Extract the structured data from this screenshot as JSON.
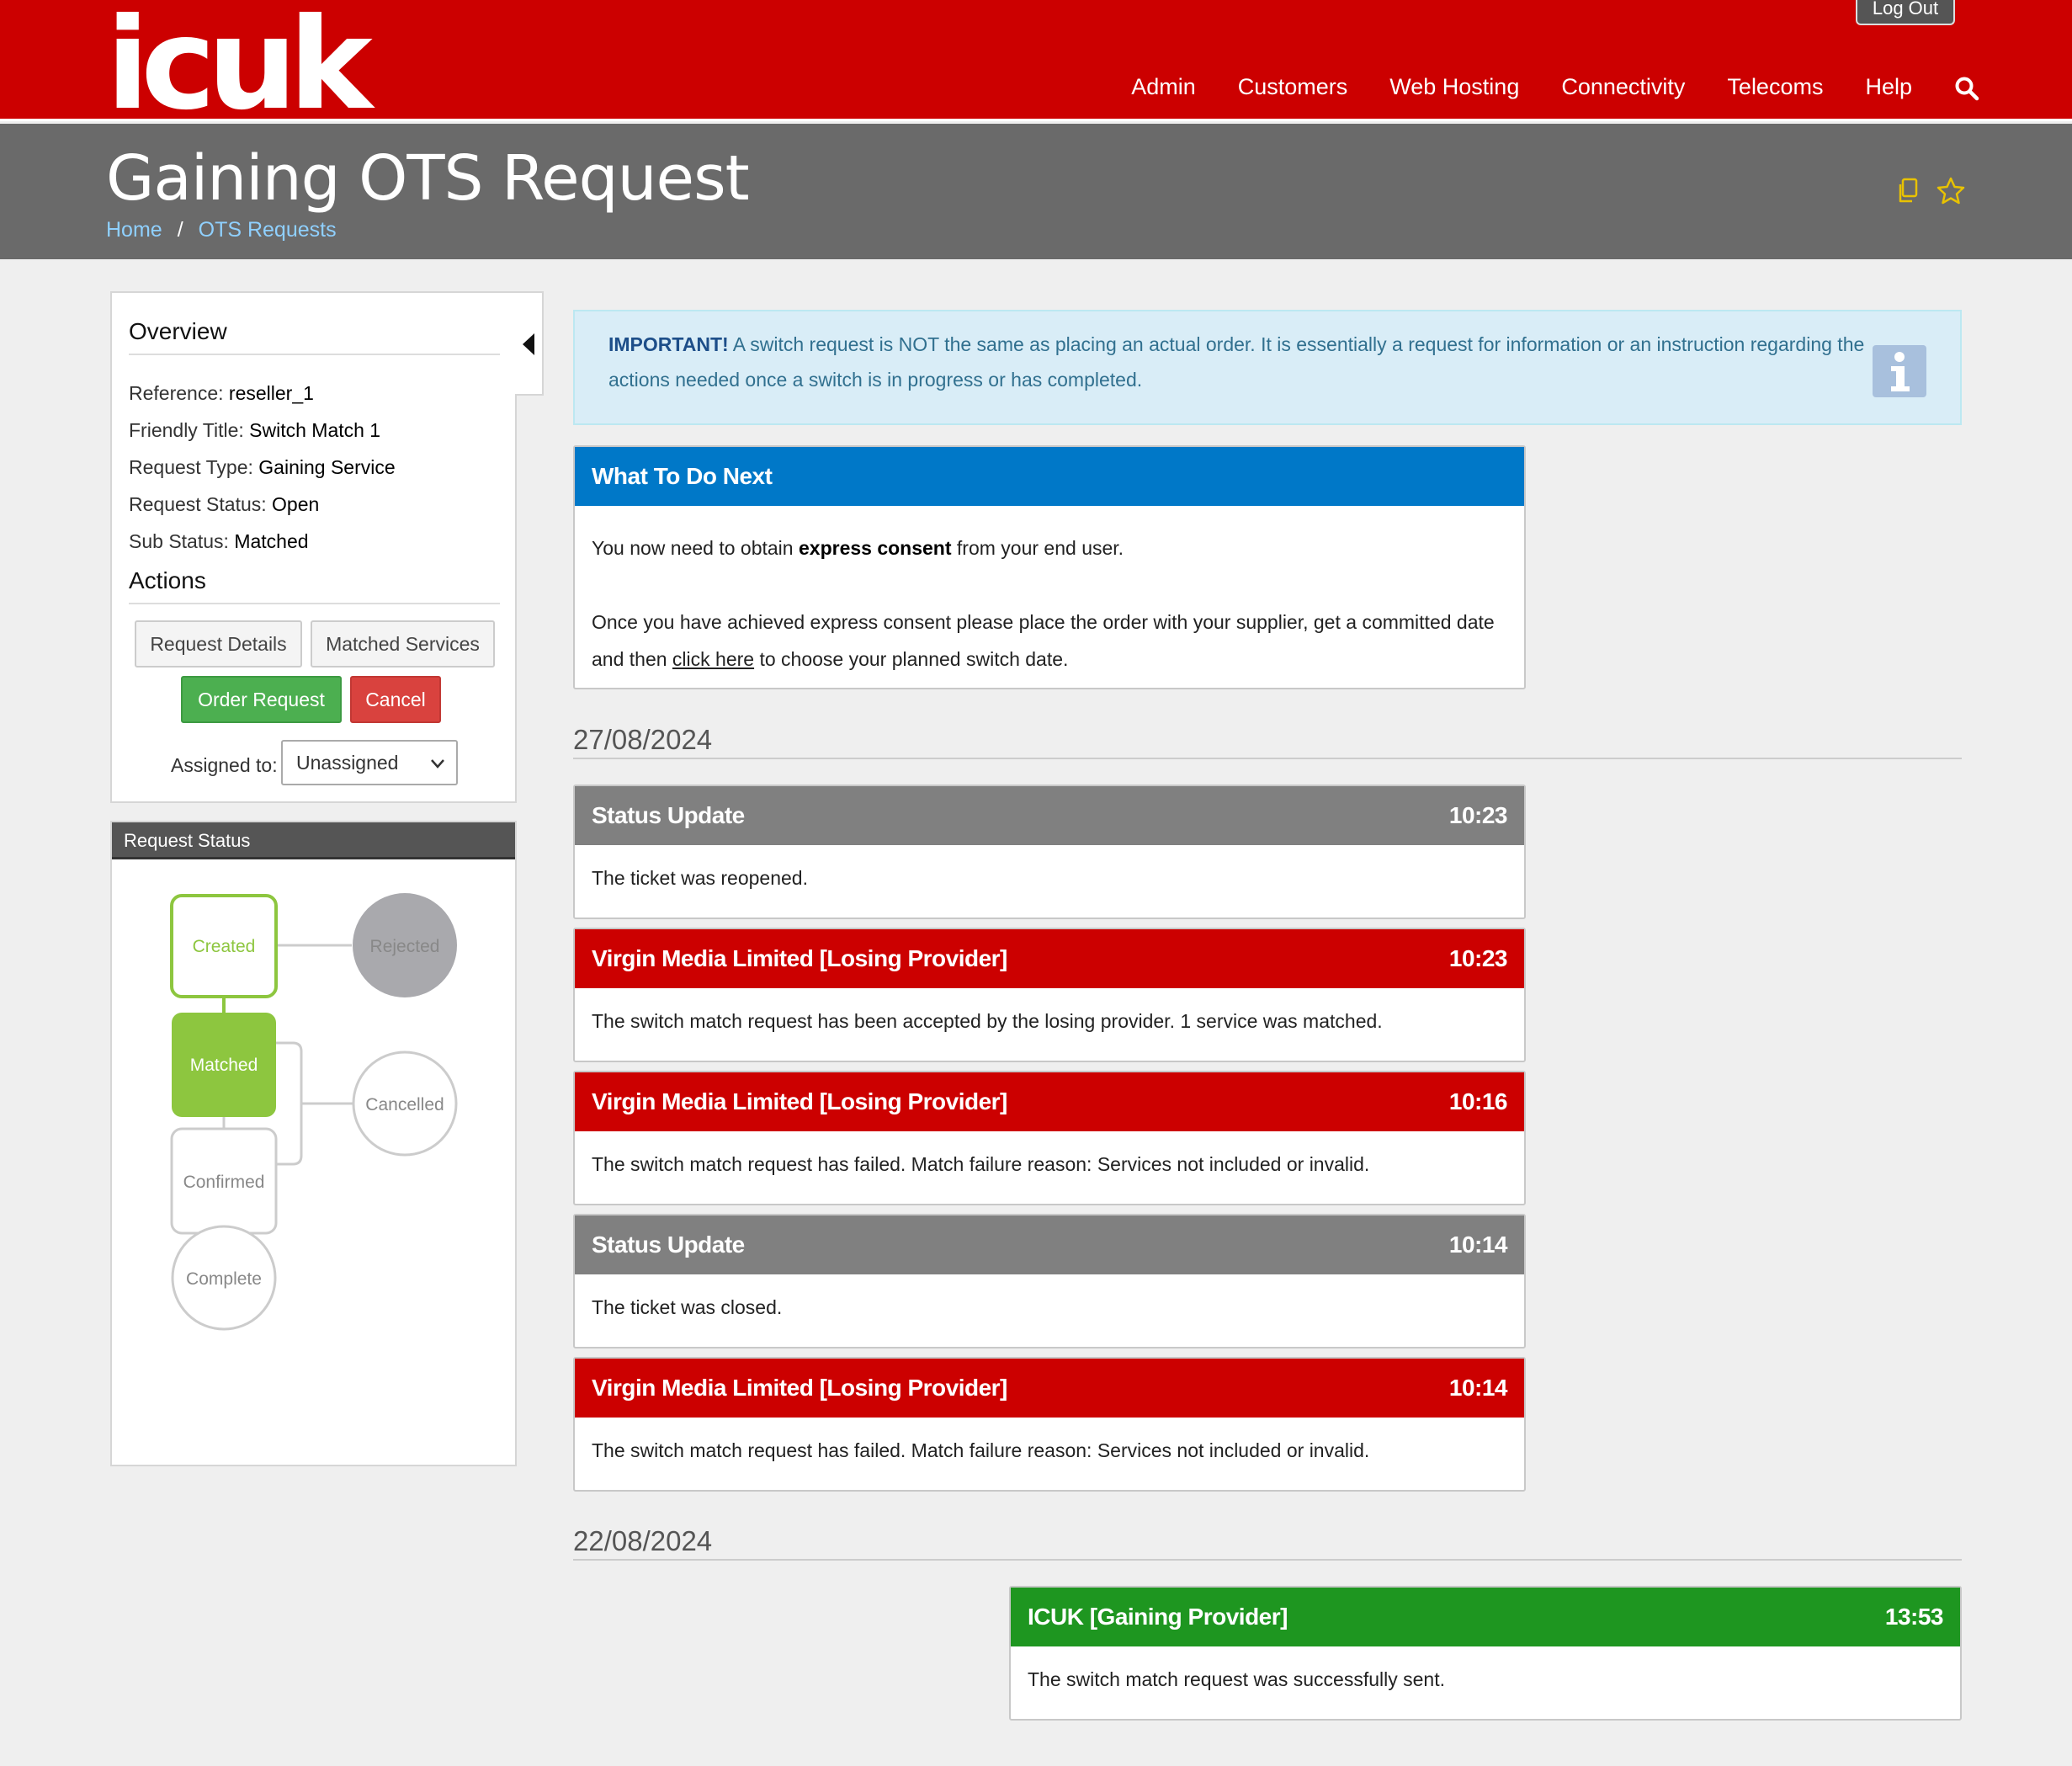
{
  "header": {
    "logo": "icuk",
    "logout_label": "Log Out",
    "nav": [
      "Admin",
      "Customers",
      "Web Hosting",
      "Connectivity",
      "Telecoms",
      "Help"
    ]
  },
  "page": {
    "title": "Gaining OTS Request",
    "breadcrumb": [
      "Home",
      "OTS Requests"
    ],
    "breadcrumb_sep": "/"
  },
  "overview": {
    "heading": "Overview",
    "fields": [
      {
        "label": "Reference: ",
        "value": "reseller_1"
      },
      {
        "label": "Friendly Title: ",
        "value": "Switch Match 1"
      },
      {
        "label": "Request Type: ",
        "value": "Gaining Service"
      },
      {
        "label": "Request Status: ",
        "value": "Open"
      },
      {
        "label": "Sub Status: ",
        "value": "Matched"
      }
    ],
    "actions_heading": "Actions",
    "buttons": {
      "request_details": "Request Details",
      "matched_services": "Matched Services",
      "order_request": "Order Request",
      "cancel": "Cancel"
    },
    "assigned_label": "Assigned to:",
    "assigned_value": "Unassigned"
  },
  "request_status": {
    "heading": "Request Status",
    "states": {
      "created": "Created",
      "rejected": "Rejected",
      "matched": "Matched",
      "cancelled": "Cancelled",
      "confirmed": "Confirmed",
      "complete": "Complete"
    }
  },
  "alert": {
    "strong": "IMPORTANT!",
    "text": " A switch request is NOT the same as placing an actual order. It is essentially a request for information or an instruction regarding the actions needed once a switch is in progress or has completed."
  },
  "next": {
    "title": "What To Do Next",
    "line1_pre": "You now need to obtain ",
    "line1_strong": "express consent",
    "line1_post": " from your end user.",
    "line2_pre": "Once you have achieved express consent please place the order with your supplier, get a committed date and then ",
    "line2_link": "click here",
    "line2_post": " to choose your planned switch date."
  },
  "timeline": {
    "date1": "27/08/2024",
    "date2": "22/08/2024",
    "events": [
      {
        "title": "Status Update",
        "time": "10:23",
        "body": "The ticket was reopened."
      },
      {
        "title": "Virgin Media Limited [Losing Provider]",
        "time": "10:23",
        "body": "The switch match request has been accepted by the losing provider. 1 service was matched."
      },
      {
        "title": "Virgin Media Limited [Losing Provider]",
        "time": "10:16",
        "body": "The switch match request has failed. Match failure reason: Services not included or invalid."
      },
      {
        "title": "Status Update",
        "time": "10:14",
        "body": "The ticket was closed."
      },
      {
        "title": "Virgin Media Limited [Losing Provider]",
        "time": "10:14",
        "body": "The switch match request has failed. Match failure reason: Services not included or invalid."
      },
      {
        "title": "ICUK [Gaining Provider]",
        "time": "13:53",
        "body": "The switch match request was successfully sent."
      }
    ]
  },
  "colors": {
    "brand_red": "#cc0000",
    "header_grey": "#6a6a6a",
    "accent_blue": "#0078c8",
    "success_green": "#1e9620",
    "status_green": "#8dc63f"
  },
  "icons": [
    "search-icon",
    "copy-icon",
    "star-icon",
    "collapse-left-icon",
    "info-icon",
    "chevron-down-icon"
  ]
}
